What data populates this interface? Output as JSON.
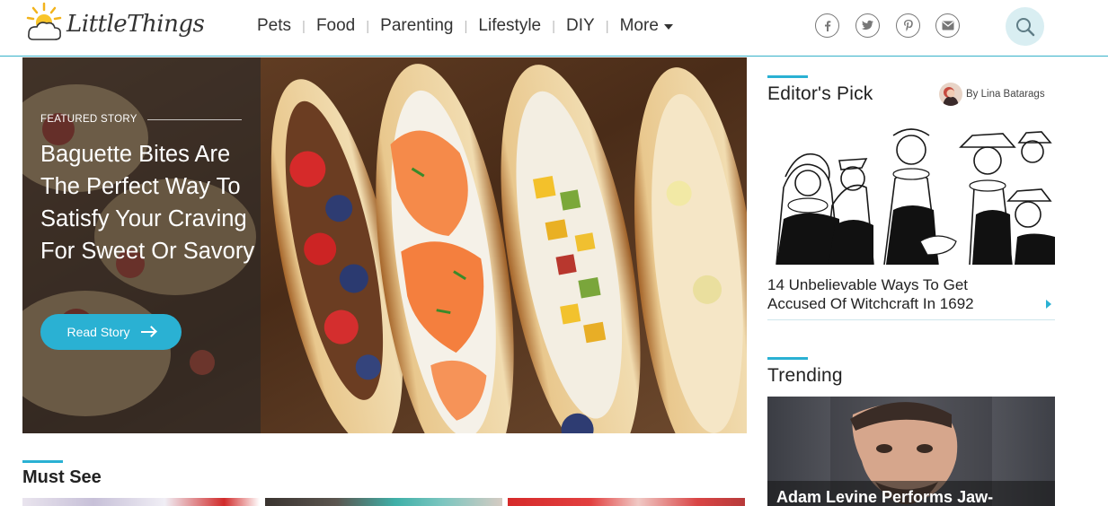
{
  "header": {
    "logo_text": "LittleThings",
    "nav": [
      {
        "label": "Pets"
      },
      {
        "label": "Food"
      },
      {
        "label": "Parenting"
      },
      {
        "label": "Lifestyle"
      },
      {
        "label": "DIY"
      }
    ],
    "more_label": "More",
    "social_icons": [
      "facebook-icon",
      "twitter-icon",
      "pinterest-icon",
      "email-icon"
    ],
    "search_icon": "search-icon"
  },
  "hero": {
    "label": "FEATURED STORY",
    "title": "Baguette Bites Are The Perfect Way To Satisfy Your Craving For Sweet Or Savory",
    "button_label": "Read Story"
  },
  "editors_pick": {
    "title": "Editor's Pick",
    "author": "By Lina Batarags",
    "caption": "14 Unbelievable Ways To Get Accused Of Witchcraft In 1692"
  },
  "trending": {
    "title": "Trending",
    "caption": "Adam Levine Performs Jaw-"
  },
  "must_see": {
    "title": "Must See"
  },
  "colors": {
    "accent": "#2ab1d3",
    "header_border": "#36b1c9",
    "search_bg": "#d9eef2"
  }
}
